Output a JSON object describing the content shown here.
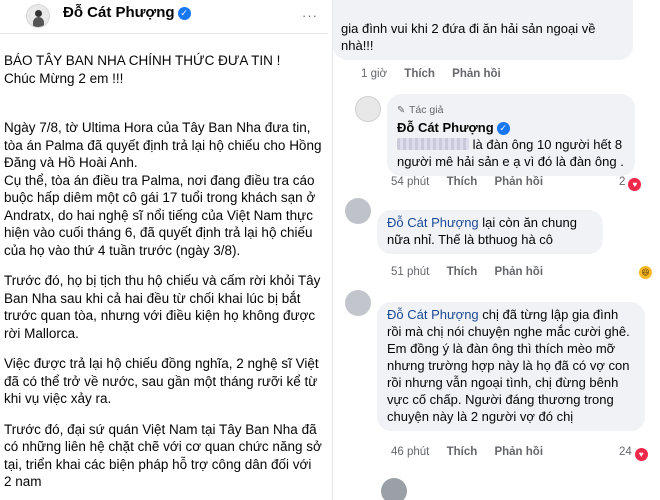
{
  "post": {
    "author": "Đỗ Cát Phượng",
    "more": "···",
    "paragraphs": [
      "BÁO TÂY BAN NHA CHÍNH THỨC ĐƯA TIN !",
      "Chúc Mừng 2 em !!!",
      "Ngày 7/8, tờ Ultima Hora của Tây Ban Nha đưa tin, tòa án Palma đã quyết định trả lại hộ chiếu cho Hồng Đăng và Hồ Hoài Anh.",
      "Cụ thể, tòa án điều tra Palma, nơi đang điều tra cáo buộc hấp diêm một cô gái 17 tuổi trong khách sạn ở Andratx, do hai nghệ sĩ nổi tiếng của Việt Nam thực hiện vào cuối tháng 6, đã quyết định trả lại hộ chiếu của họ vào thứ 4 tuần trước (ngày 3/8).",
      "Trước đó, họ bị tịch thu hộ chiếu và cấm rời khỏi Tây Ban Nha sau khi cả hai đều từ chối khai lúc bị bắt trước quan tòa, nhưng với điều kiện họ không được rời Mallorca.",
      "Việc được trả lại hộ chiếu đồng nghĩa, 2 nghệ sĩ Việt đã có thể trở về nước, sau gần một tháng rưỡi kể từ khi vụ việc xảy ra.",
      "Trước đó, đại sứ quán Việt Nam tại Tây Ban Nha đã có những liên hệ chặt chẽ với cơ quan chức năng sở tại, triển khai các biện pháp hỗ trợ công dân đối với 2 nam"
    ]
  },
  "comments": [
    {
      "text": "gia đình vui khi 2 đứa đi ăn hải sản ngoại về nhà!!!",
      "time": "1 giờ",
      "like": "Thích",
      "reply": "Phản hồi"
    },
    {
      "author_tag": "Tác giả",
      "name": "Đỗ Cát Phượng",
      "text": "là đàn ông 10 người hết 8 người mê hải sản e ạ vì đó là đàn ông .",
      "time": "54 phút",
      "like": "Thích",
      "reply": "Phản hồi",
      "reactions": "2"
    },
    {
      "name": "Đỗ Cát Phượng",
      "text": "lại còn ăn chung nữa nhỉ. Thế là bthuog hà cô",
      "time": "51 phút",
      "like": "Thích",
      "reply": "Phản hồi"
    },
    {
      "name": "Đỗ Cát Phượng",
      "text": "chị đã từng lập gia đình rồi mà chị nói chuyện nghe mắc cười ghê. Em đồng ý là đàn ông thì thích mèo mỡ nhưng trường hợp này là họ đã có vợ con rồi nhưng vẫn ngoại tình, chị đừng bênh vực cố chấp. Người đáng thương trong chuyện này là 2 người vợ đó chị",
      "time": "46 phút",
      "like": "Thích",
      "reply": "Phản hồi",
      "reactions": "24"
    }
  ],
  "colors": {
    "bubble": "#f0f2f5",
    "meta": "#65676b",
    "verified": "#1877f2",
    "mention": "#1c4b96"
  }
}
